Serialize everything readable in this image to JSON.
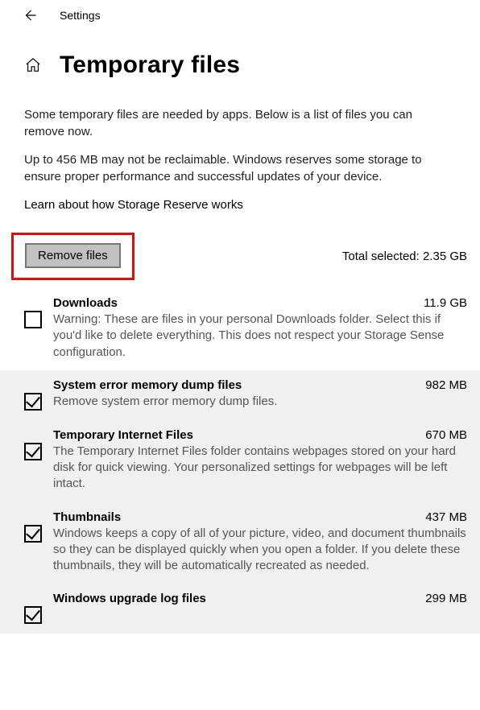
{
  "topbar": {
    "title": "Settings"
  },
  "page": {
    "title": "Temporary files"
  },
  "intro": {
    "p1": "Some temporary files are needed by apps. Below is a list of files you can remove now.",
    "p2": "Up to 456 MB may not be reclaimable. Windows reserves some storage to ensure proper performance and successful updates of your device.",
    "link": "Learn about how Storage Reserve works"
  },
  "action": {
    "remove_label": "Remove files",
    "total_label": "Total selected: 2.35 GB"
  },
  "items": [
    {
      "title": "Downloads",
      "size": "11.9 GB",
      "desc": "Warning: These are files in your personal Downloads folder. Select this if you'd like to delete everything. This does not respect your Storage Sense configuration.",
      "checked": false
    },
    {
      "title": "System error memory dump files",
      "size": "982 MB",
      "desc": "Remove system error memory dump files.",
      "checked": true
    },
    {
      "title": "Temporary Internet Files",
      "size": "670 MB",
      "desc": "The Temporary Internet Files folder contains webpages stored on your hard disk for quick viewing. Your personalized settings for webpages will be left intact.",
      "checked": true
    },
    {
      "title": "Thumbnails",
      "size": "437 MB",
      "desc": "Windows keeps a copy of all of your picture, video, and document thumbnails so they can be displayed quickly when you open a folder. If you delete these thumbnails, they will be automatically recreated as needed.",
      "checked": true
    },
    {
      "title": "Windows upgrade log files",
      "size": "299 MB",
      "desc": "",
      "checked": true
    }
  ]
}
